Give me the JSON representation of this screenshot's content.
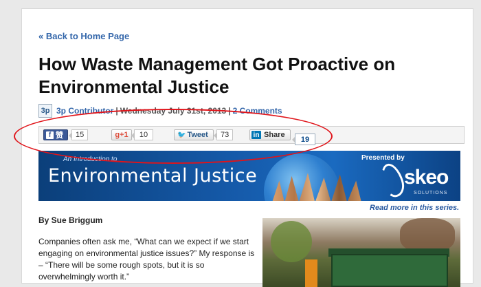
{
  "nav": {
    "back_link": "« Back to Home Page"
  },
  "article": {
    "title": "How Waste Management Got Proactive on Environmental Justice",
    "byline": {
      "logo_text": "3p",
      "contributor": "3p Contributor",
      "separator": "|",
      "date": "Wednesday July 31st, 2013",
      "comments": "2 Comments"
    },
    "author": "By Sue Briggum",
    "body": "Companies often ask me, “What can we expect if we start engaging on environmental justice issues?” My response is – “There will be some rough spots, but it is so overwhelmingly worth it.”"
  },
  "share_bar": {
    "facebook": {
      "icon": "facebook-icon",
      "label": "赞",
      "count": "15"
    },
    "google_plus": {
      "label": "g+1",
      "count": "10"
    },
    "twitter": {
      "icon": "twitter-bird-icon",
      "label": "Tweet",
      "count": "73"
    },
    "linkedin": {
      "icon": "linkedin-icon",
      "icon_text": "in",
      "label": "Share",
      "count": "19"
    }
  },
  "banner": {
    "intro": "An Introduction to",
    "heading": "Environmental Justice",
    "presented_by": "Presented by",
    "brand": "skeo",
    "brand_sub": "SOLUTIONS"
  },
  "series_link": "Read more in this series.",
  "colors": {
    "link": "#3366aa",
    "annotation_oval": "#e0141a",
    "banner_blue": "#1559a8"
  }
}
